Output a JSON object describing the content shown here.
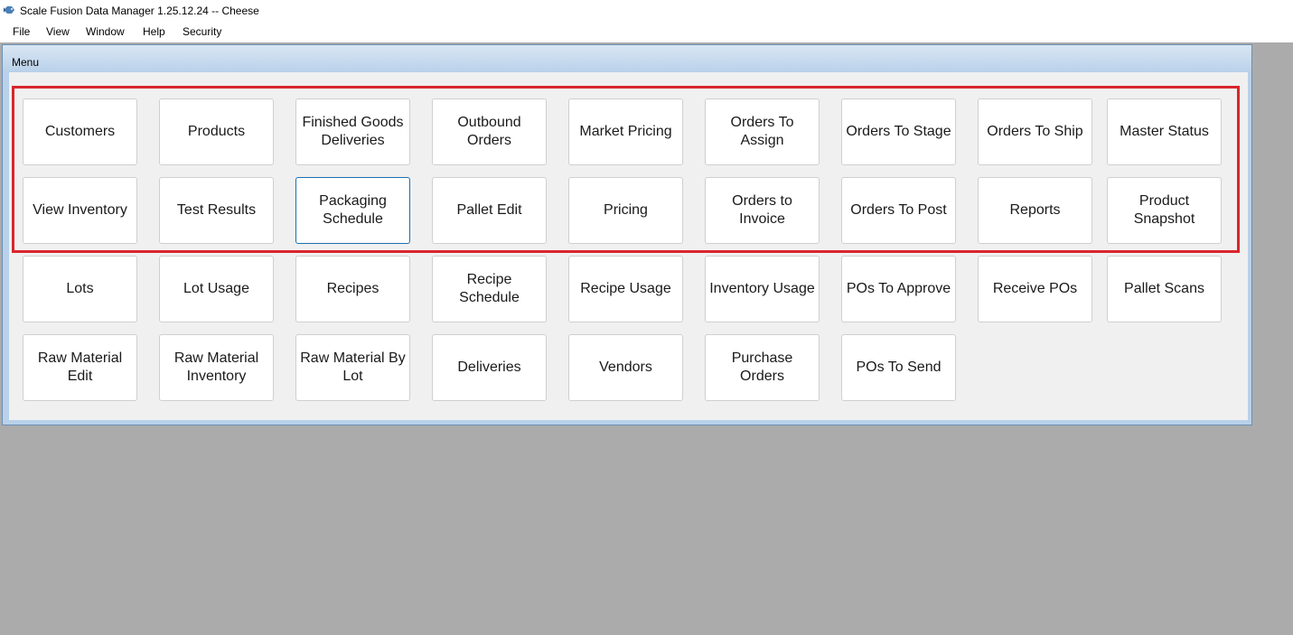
{
  "window": {
    "title": "Scale Fusion Data Manager 1.25.12.24 -- Cheese",
    "app_icon": "fish-logo-icon"
  },
  "menubar": {
    "items": [
      "File",
      "View",
      "Window",
      "Help",
      "Security"
    ]
  },
  "child_window": {
    "title": "Menu"
  },
  "colors": {
    "highlight": "#d9262c",
    "focus_border": "#1a6fb0",
    "mdi_background": "#ababab"
  },
  "buttons": {
    "row1": [
      "Customers",
      "Products",
      "Finished Goods Deliveries",
      "Outbound Orders",
      "Market Pricing",
      "Orders To Assign",
      "Orders To Stage",
      "Orders To Ship",
      "Master Status"
    ],
    "row2": [
      "View Inventory",
      "Test Results",
      "Packaging Schedule",
      "Pallet Edit",
      "Pricing",
      "Orders to Invoice",
      "Orders To Post",
      "Reports",
      "Product Snapshot"
    ],
    "row3": [
      "Lots",
      "Lot Usage",
      "Recipes",
      "Recipe Schedule",
      "Recipe Usage",
      "Inventory Usage",
      "POs To Approve",
      "Receive POs",
      "Pallet Scans"
    ],
    "row4": [
      "Raw Material Edit",
      "Raw Material Inventory",
      "Raw Material By Lot",
      "Deliveries",
      "Vendors",
      "Purchase Orders",
      "POs To Send"
    ]
  },
  "focused_button": "Packaging Schedule"
}
